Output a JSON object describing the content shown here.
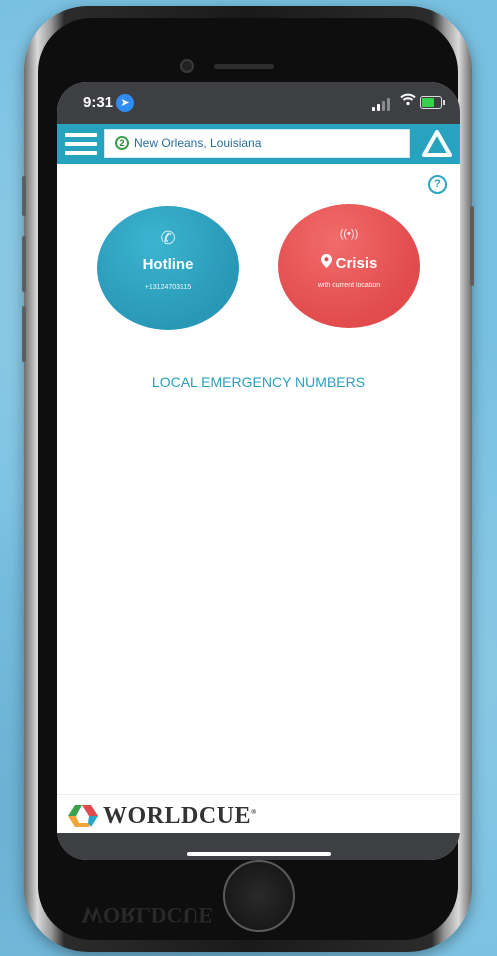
{
  "status_bar": {
    "time": "9:31"
  },
  "header": {
    "location_badge": "2",
    "location_text": "New Orleans, Louisiana"
  },
  "help": {
    "icon": "?"
  },
  "hotline": {
    "title": "Hotline",
    "number": "+13124703115"
  },
  "crisis": {
    "title": "Crisis",
    "subtitle": "with current location"
  },
  "local_numbers": {
    "label": "LOCAL EMERGENCY NUMBERS"
  },
  "footer": {
    "brand": "WORLDCUE",
    "trademark": "®"
  },
  "colors": {
    "accent": "#27a3bf",
    "crisis": "#e14b4c",
    "status_bar": "#3d3f42"
  }
}
